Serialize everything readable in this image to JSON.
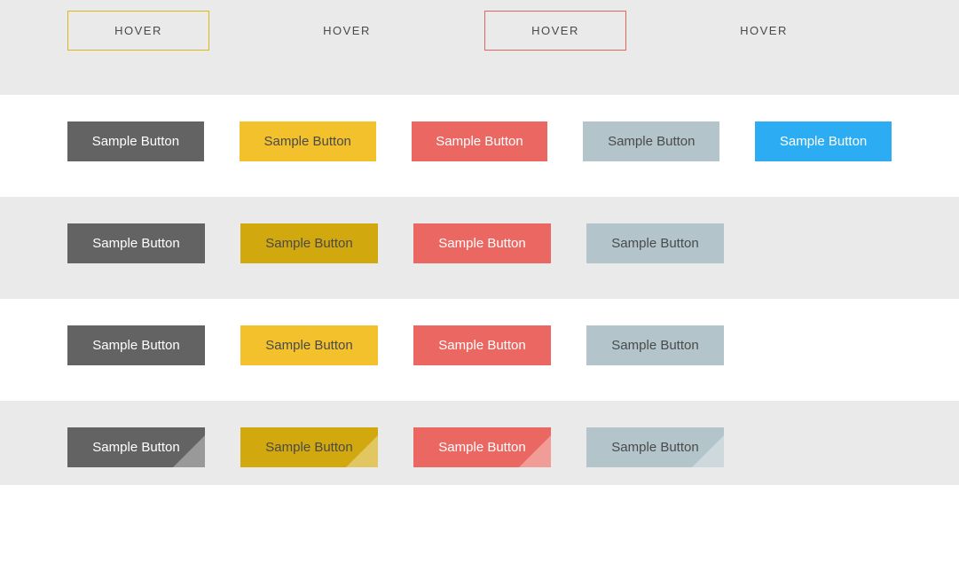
{
  "hover_row": {
    "btn1_label": "HOVER",
    "btn2_label": "HOVER",
    "btn3_label": "HOVER",
    "btn4_label": "HOVER"
  },
  "row1": {
    "dark": "Sample Button",
    "yellow": "Sample Button",
    "red": "Sample Button",
    "gray": "Sample Button",
    "blue": "Sample Button"
  },
  "row2": {
    "dark": "Sample Button",
    "yellow": "Sample Button",
    "red": "Sample Button",
    "gray": "Sample Button"
  },
  "row3": {
    "dark": "Sample Button",
    "yellow": "Sample Button",
    "red": "Sample Button",
    "gray": "Sample Button"
  },
  "row4": {
    "dark": "Sample Button",
    "yellow": "Sample Button",
    "red": "Sample Button",
    "gray": "Sample Button"
  },
  "colors": {
    "dark": "#636363",
    "yellow": "#f3c12b",
    "yellow_dark": "#d1a80e",
    "red": "#eb6762",
    "gray": "#b3c5cb",
    "blue": "#2cadf3"
  }
}
